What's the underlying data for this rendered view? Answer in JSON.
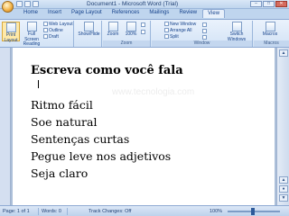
{
  "window": {
    "title": "Document1 - Microsoft Word (Trial)",
    "minimize": "–",
    "maximize": "□",
    "close": "✕"
  },
  "tabs": [
    "Home",
    "Insert",
    "Page Layout",
    "References",
    "Mailings",
    "Review",
    "View"
  ],
  "ribbon": {
    "print_layout": "Print Layout",
    "full_screen_reading": "Full Screen Reading",
    "web_layout": "Web Layout",
    "outline": "Outline",
    "draft": "Draft",
    "show_hide": "Show/Hide",
    "zoom": "Zoom",
    "zoom_100": "100%",
    "new_window": "New Window",
    "arrange_all": "Arrange All",
    "split": "Split",
    "switch_windows": "Switch Windows",
    "macros": "Macros",
    "group_zoom": "Zoom",
    "group_window": "Window",
    "group_macros": "Macros"
  },
  "document": {
    "title": "Escreva como você fala",
    "watermark": "www.tecnologia.com",
    "lines": [
      "Ritmo fácil",
      "Soe natural",
      "Sentenças curtas",
      "Pegue leve nos adjetivos",
      "Seja claro"
    ]
  },
  "statusbar": {
    "page": "Page: 1 of 1",
    "words": "Words: 0",
    "track_changes": "Track Changes: Off",
    "zoom": "100%"
  },
  "colors": {
    "ribbon_bg": "#d3e3f6",
    "tab_text": "#15428b",
    "doc_bg": "#acbfd9"
  }
}
